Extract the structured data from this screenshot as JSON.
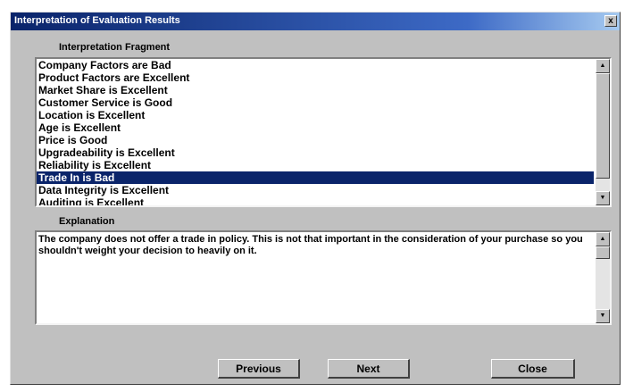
{
  "window": {
    "title": "Interpretation of Evaluation Results",
    "close_glyph": "x"
  },
  "fragment_list": {
    "label": "Interpretation Fragment",
    "items": [
      "Company Factors are Bad",
      "Product Factors are Excellent",
      "Market Share is Excellent",
      "Customer Service is Good",
      "Location is Excellent",
      "Age is Excellent",
      "Price is Good",
      "Upgradeability is Excellent",
      "Reliability is Excellent",
      "Trade In is Bad",
      "Data Integrity is Excellent",
      "Auditing is Excellent"
    ],
    "selected": "Trade In is Bad"
  },
  "explanation": {
    "label": "Explanation",
    "text": "The company does not offer a trade in policy. This is not that important in the consideration of your purchase so you shouldn't weight your decision to heavily on it."
  },
  "buttons": {
    "previous": "Previous",
    "next": "Next",
    "close": "Close"
  },
  "scroll_glyphs": {
    "up": "▲",
    "down": "▼"
  },
  "colors": {
    "title_bar_start": "#0a246a",
    "title_bar_end": "#a6caf0",
    "selection": "#0a246a",
    "dialog_face": "#c0c0c0"
  }
}
